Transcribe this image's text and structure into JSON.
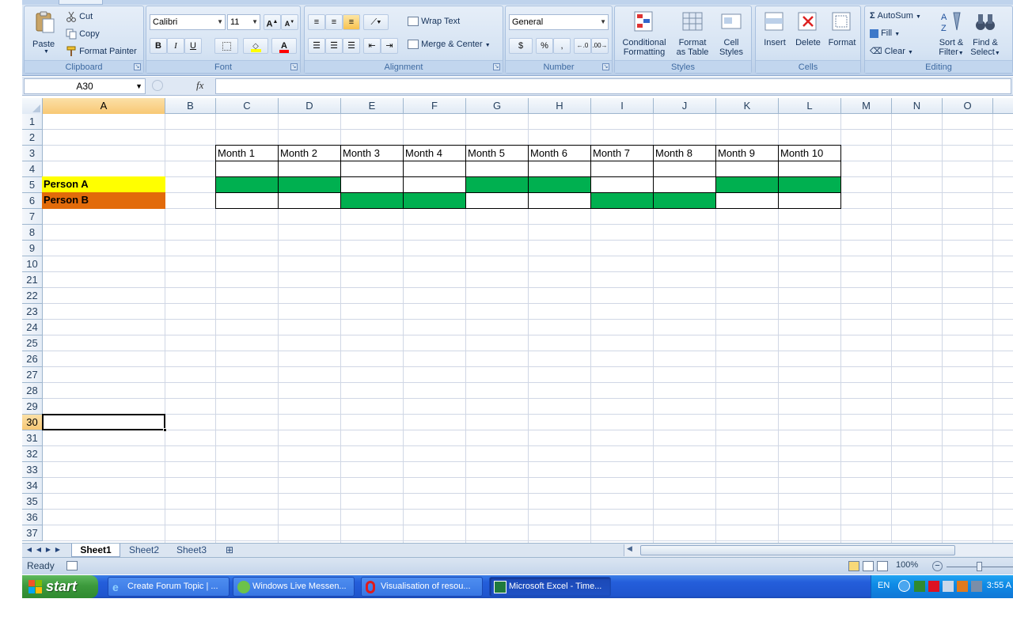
{
  "ribbon": {
    "clipboard": {
      "label": "Clipboard",
      "paste": "Paste",
      "cut": "Cut",
      "copy": "Copy",
      "format_painter": "Format Painter"
    },
    "font": {
      "label": "Font",
      "family": "Calibri",
      "size": "11",
      "bold": "B",
      "italic": "I",
      "underline": "U"
    },
    "alignment": {
      "label": "Alignment",
      "wrap_text": "Wrap Text",
      "merge_center": "Merge & Center"
    },
    "number": {
      "label": "Number",
      "format": "General",
      "currency": "$",
      "percent": "%",
      "comma": ","
    },
    "styles": {
      "label": "Styles",
      "conditional_1": "Conditional",
      "conditional_2": "Formatting",
      "format_table_1": "Format",
      "format_table_2": "as Table",
      "cell_styles_1": "Cell",
      "cell_styles_2": "Styles"
    },
    "cells": {
      "label": "Cells",
      "insert": "Insert",
      "delete": "Delete",
      "format": "Format"
    },
    "editing": {
      "label": "Editing",
      "autosum": "AutoSum",
      "fill": "Fill",
      "clear": "Clear",
      "sort_1": "Sort &",
      "sort_2": "Filter",
      "find_1": "Find &",
      "find_2": "Select"
    }
  },
  "formula_bar": {
    "name_box": "A30",
    "fx": "fx",
    "formula": ""
  },
  "sheet": {
    "columns": [
      "A",
      "B",
      "C",
      "D",
      "E",
      "F",
      "G",
      "H",
      "I",
      "J",
      "K",
      "L",
      "M",
      "N",
      "O"
    ],
    "rows": [
      "1",
      "2",
      "3",
      "4",
      "5",
      "6",
      "7",
      "8",
      "9",
      "10",
      "21",
      "22",
      "23",
      "24",
      "25",
      "26",
      "27",
      "28",
      "29",
      "30",
      "31",
      "32",
      "33",
      "34",
      "35",
      "36",
      "37"
    ],
    "selected_column": "A",
    "selected_row": "30",
    "month_headers": [
      "Month 1",
      "Month 2",
      "Month 3",
      "Month 4",
      "Month 5",
      "Month 6",
      "Month 7",
      "Month 8",
      "Month 9",
      "Month 10"
    ],
    "person_a": {
      "label": "Person A",
      "fill": "#ffff00",
      "active_months": [
        1,
        2,
        5,
        6,
        9,
        10
      ]
    },
    "person_b": {
      "label": "Person B",
      "fill": "#e26b0a",
      "active_months": [
        3,
        4,
        7,
        8
      ]
    },
    "active_color": "#00b050"
  },
  "sheet_tabs": [
    "Sheet1",
    "Sheet2",
    "Sheet3"
  ],
  "status": {
    "ready": "Ready",
    "zoom": "100%"
  },
  "taskbar": {
    "start": "start",
    "tasks": [
      "Create Forum Topic | ...",
      "Windows Live Messen...",
      "Visualisation of resou...",
      "Microsoft Excel - Time..."
    ],
    "lang": "EN",
    "clock": "3:55 A"
  }
}
